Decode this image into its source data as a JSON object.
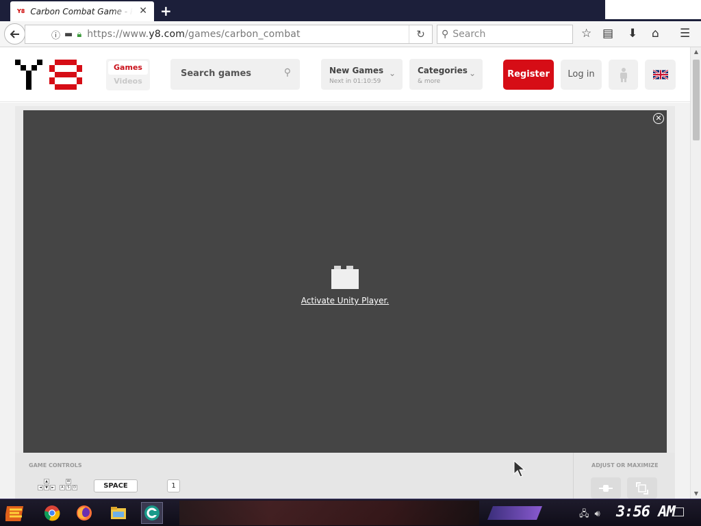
{
  "browser": {
    "tab_title": "Carbon Combat Game - Play",
    "tab_favicon": "Y8",
    "new_tab_icon": "plus-icon",
    "url_prefix": "https://www.",
    "url_domain": "y8.com",
    "url_path": "/games/carbon_combat",
    "search_placeholder": "Search"
  },
  "site": {
    "logo": "Y8",
    "toggle": {
      "games": "Games",
      "videos": "Videos"
    },
    "search_placeholder": "Search games",
    "new_games": {
      "label": "New Games",
      "sub": "Next in 01:10:59"
    },
    "categories": {
      "label": "Categories",
      "sub": "& more"
    },
    "register": "Register",
    "login": "Log in",
    "brand_color": "#d60d16"
  },
  "player": {
    "activate_text": "Activate Unity Player.",
    "bg_color": "#454545"
  },
  "controls": {
    "title": "GAME CONTROLS",
    "adjust_title": "ADJUST OR MAXIMIZE",
    "arrow_keys": [
      "▲",
      "◄",
      "▼",
      "►"
    ],
    "wasd_keys": [
      "W",
      "A",
      "S",
      "D"
    ],
    "space_key": "SPACE",
    "one_key": "1"
  },
  "taskbar": {
    "clock": "3:56 AM",
    "apps": [
      "chrome-icon",
      "firefox-icon",
      "file-explorer-icon",
      "app-icon"
    ]
  }
}
